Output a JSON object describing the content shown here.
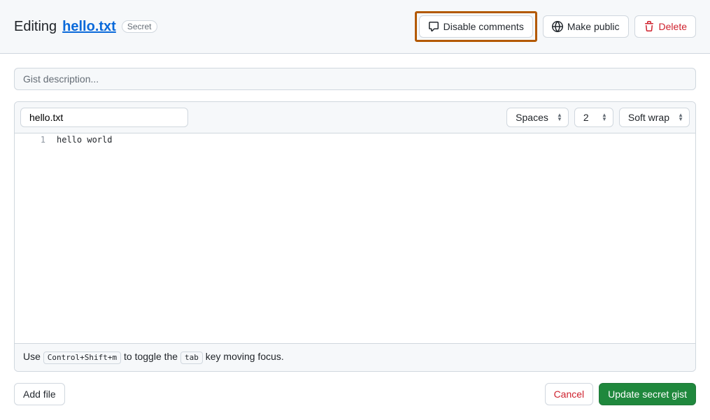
{
  "header": {
    "editing_label": "Editing",
    "file_name": "hello.txt",
    "badge": "Secret",
    "disable_comments": "Disable comments",
    "make_public": "Make public",
    "delete": "Delete"
  },
  "description": {
    "placeholder": "Gist description..."
  },
  "file": {
    "filename": "hello.txt",
    "indent_mode": "Spaces",
    "indent_size": "2",
    "wrap_mode": "Soft wrap",
    "lines": [
      {
        "number": "1",
        "text": "hello world"
      }
    ],
    "footer_prefix": "Use",
    "footer_kbd1": "Control+Shift+m",
    "footer_mid": "to toggle the",
    "footer_kbd2": "tab",
    "footer_suffix": "key moving focus."
  },
  "actions": {
    "add_file": "Add file",
    "cancel": "Cancel",
    "update": "Update secret gist"
  }
}
